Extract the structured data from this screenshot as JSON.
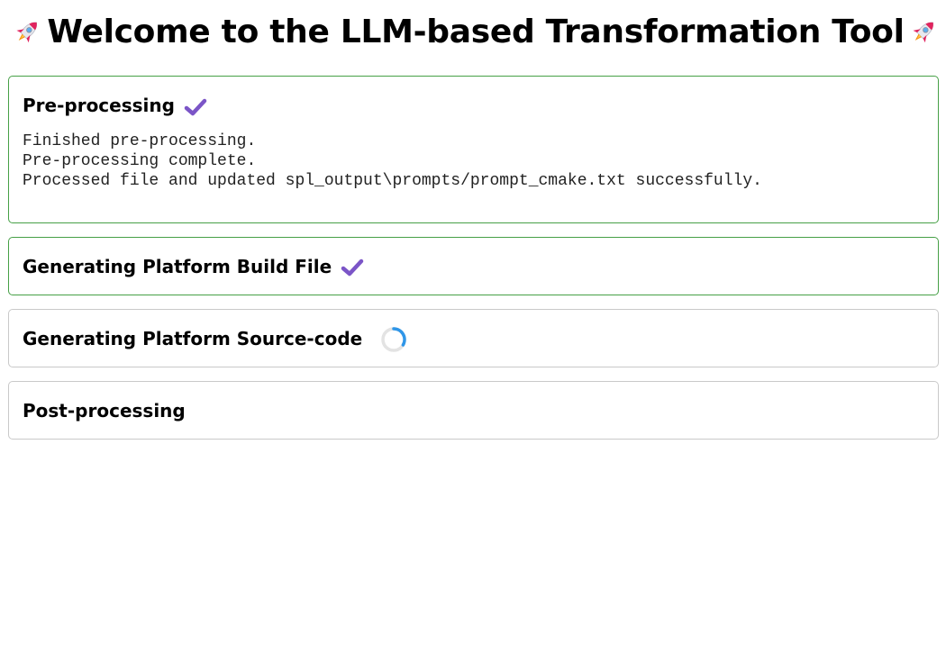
{
  "header": {
    "title": "Welcome to the LLM-based Transformation Tool",
    "left_icon": "rocket-icon",
    "right_icon": "rocket-icon"
  },
  "colors": {
    "done_border": "#46a046",
    "pending_border": "#c9c9c9",
    "check": "#7b55c7",
    "spinner_track": "#e3e3e3",
    "spinner_arc": "#2f96e8"
  },
  "steps": [
    {
      "title": "Pre-processing",
      "status": "done",
      "status_icon": "check-icon",
      "log": [
        "Finished pre-processing.",
        "Pre-processing complete.",
        "Processed file and updated spl_output\\prompts/prompt_cmake.txt successfully."
      ]
    },
    {
      "title": "Generating Platform Build File",
      "status": "done",
      "status_icon": "check-icon"
    },
    {
      "title": "Generating Platform Source-code",
      "status": "running",
      "status_icon": "spinner-icon"
    },
    {
      "title": "Post-processing",
      "status": "pending"
    }
  ]
}
